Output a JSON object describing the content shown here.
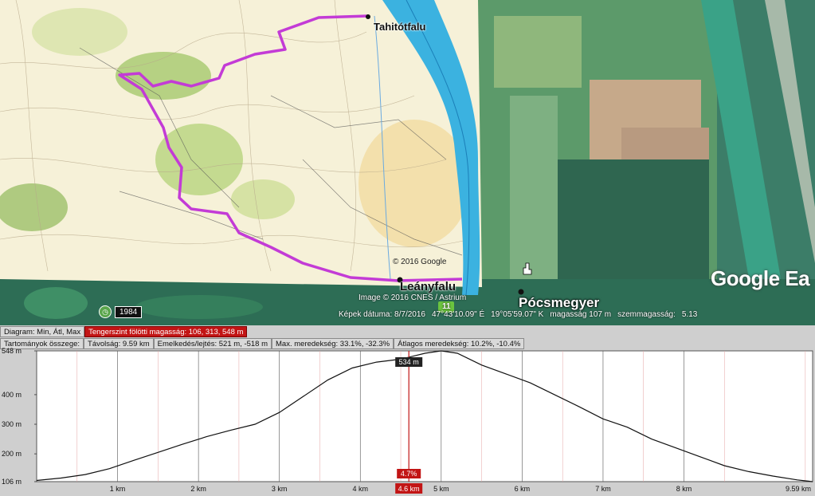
{
  "map": {
    "towns": {
      "tahitotfalu": "Tahitótfalu",
      "leanyfalu": "Leányfalu",
      "pocsmegyer": "Pócsmegyer"
    },
    "copyright_top": "© 2016 Google",
    "copyright_image": "Image © 2016 CNES / Astrium",
    "logo": "Google Ea",
    "route_marker": "11",
    "history_year": "1984",
    "history_icon": "clock-icon",
    "status": {
      "image_date": "Képek dátuma: 8/7/2016",
      "lat": "47°43'10.09\" É",
      "lon": "19°05'59.07\" K",
      "altitude": "magasság   107 m",
      "eye_altitude": "szemmagasság:",
      "eye_value": "5.13"
    }
  },
  "profile": {
    "row1": {
      "diagram": "Diagram: Min, Átl, Max",
      "elevation": "Tengerszint fölötti magasság: 106, 313, 548 m"
    },
    "row2": {
      "range_totals": "Tartományok összege:",
      "distance": "Távolság: 9.59 km",
      "ascent": "Emelkedés/lejtés: 521 m, -518 m",
      "max_slope": "Max. meredekség: 33.1%, -32.3%",
      "avg_slope": "Átlagos meredekség: 10.2%, -10.4%"
    },
    "cursor": {
      "elevation_label": "534 m",
      "slope_label": "4.7%",
      "distance_label": "4.6 km",
      "distance_km": 4.6,
      "color": "#c21515"
    }
  },
  "chart_data": {
    "type": "area",
    "title": "",
    "xlabel": "",
    "ylabel": "",
    "x_unit": "km",
    "y_unit": "m",
    "xlim": [
      0,
      9.59
    ],
    "ylim": [
      106,
      548
    ],
    "x_ticks": [
      {
        "value": 1,
        "label": "1 km"
      },
      {
        "value": 2,
        "label": "2 km"
      },
      {
        "value": 3,
        "label": "3 km"
      },
      {
        "value": 4,
        "label": "4 km"
      },
      {
        "value": 5,
        "label": "5 km"
      },
      {
        "value": 6,
        "label": "6 km"
      },
      {
        "value": 7,
        "label": "7 km"
      },
      {
        "value": 8,
        "label": "8 km"
      },
      {
        "value": 9.59,
        "label": "9.59 km"
      }
    ],
    "y_ticks": [
      {
        "value": 548,
        "label": "548 m"
      },
      {
        "value": 400,
        "label": "400 m"
      },
      {
        "value": 300,
        "label": "300 m"
      },
      {
        "value": 200,
        "label": "200 m"
      },
      {
        "value": 106,
        "label": "106 m"
      }
    ],
    "grid": true,
    "series": [
      {
        "color": "#111111",
        "x": [
          0,
          0.3,
          0.6,
          0.9,
          1.2,
          1.5,
          1.8,
          2.1,
          2.4,
          2.7,
          3.0,
          3.3,
          3.6,
          3.9,
          4.2,
          4.5,
          4.8,
          5.0,
          5.2,
          5.5,
          5.8,
          6.1,
          6.4,
          6.7,
          7.0,
          7.3,
          7.6,
          7.9,
          8.2,
          8.5,
          8.8,
          9.1,
          9.4,
          9.59
        ],
        "y": [
          110,
          118,
          130,
          150,
          178,
          205,
          232,
          258,
          280,
          300,
          340,
          395,
          450,
          490,
          510,
          520,
          540,
          548,
          540,
          500,
          470,
          440,
          400,
          360,
          318,
          290,
          250,
          220,
          190,
          160,
          140,
          125,
          112,
          106
        ]
      }
    ]
  }
}
